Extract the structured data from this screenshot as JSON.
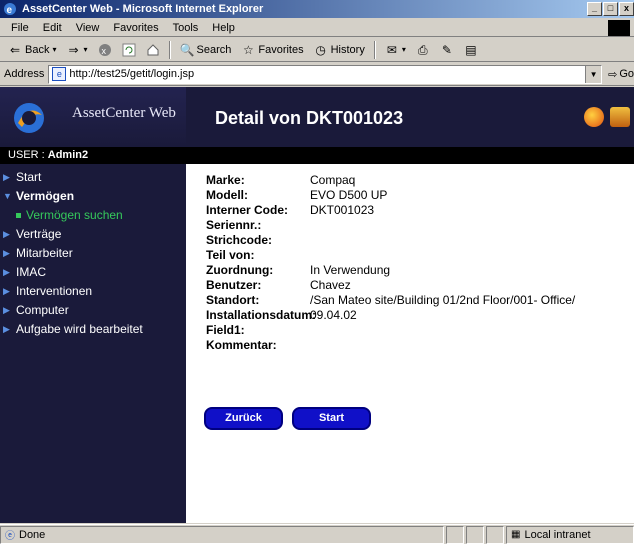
{
  "window": {
    "title": "AssetCenter Web - Microsoft Internet Explorer",
    "controls": [
      "_",
      "□",
      "x"
    ]
  },
  "menubar": {
    "items": [
      "File",
      "Edit",
      "View",
      "Favorites",
      "Tools",
      "Help"
    ]
  },
  "toolbar": {
    "back": "Back",
    "search": "Search",
    "favorites": "Favorites",
    "history": "History"
  },
  "address": {
    "label": "Address",
    "url": "http://test25/getit/login.jsp",
    "go": "Go"
  },
  "app": {
    "brand": "AssetCenter Web",
    "page_title": "Detail von DKT001023",
    "user_label": "USER :",
    "user_name": "Admin2"
  },
  "nav": [
    {
      "label": "Start"
    },
    {
      "label": "Vermögen"
    },
    {
      "label": "Vermögen suchen"
    },
    {
      "label": "Verträge"
    },
    {
      "label": "Mitarbeiter"
    },
    {
      "label": "IMAC"
    },
    {
      "label": "Interventionen"
    },
    {
      "label": "Computer"
    },
    {
      "label": "Aufgabe wird bearbeitet"
    }
  ],
  "details": [
    {
      "label": "Marke:",
      "value": "Compaq"
    },
    {
      "label": "Modell:",
      "value": "EVO D500 UP"
    },
    {
      "label": "Interner Code:",
      "value": "DKT001023"
    },
    {
      "label": "Seriennr.:",
      "value": ""
    },
    {
      "label": "Strichcode:",
      "value": ""
    },
    {
      "label": "Teil von:",
      "value": ""
    },
    {
      "label": "Zuordnung:",
      "value": "In Verwendung"
    },
    {
      "label": "Benutzer:",
      "value": "Chavez"
    },
    {
      "label": "Standort:",
      "value": "/San Mateo site/Building 01/2nd Floor/001- Office/"
    },
    {
      "label": "Installationsdatum:",
      "value": "09.04.02"
    },
    {
      "label": "Field1:",
      "value": ""
    },
    {
      "label": "Kommentar:",
      "value": ""
    }
  ],
  "buttons": {
    "back": "Zurück",
    "start": "Start"
  },
  "status": {
    "text": "Done",
    "zone": "Local intranet"
  },
  "colors": {
    "sidebar_bg": "#1a1a3a",
    "accent_green": "#35c95b",
    "button_blue": "#1010c8"
  }
}
